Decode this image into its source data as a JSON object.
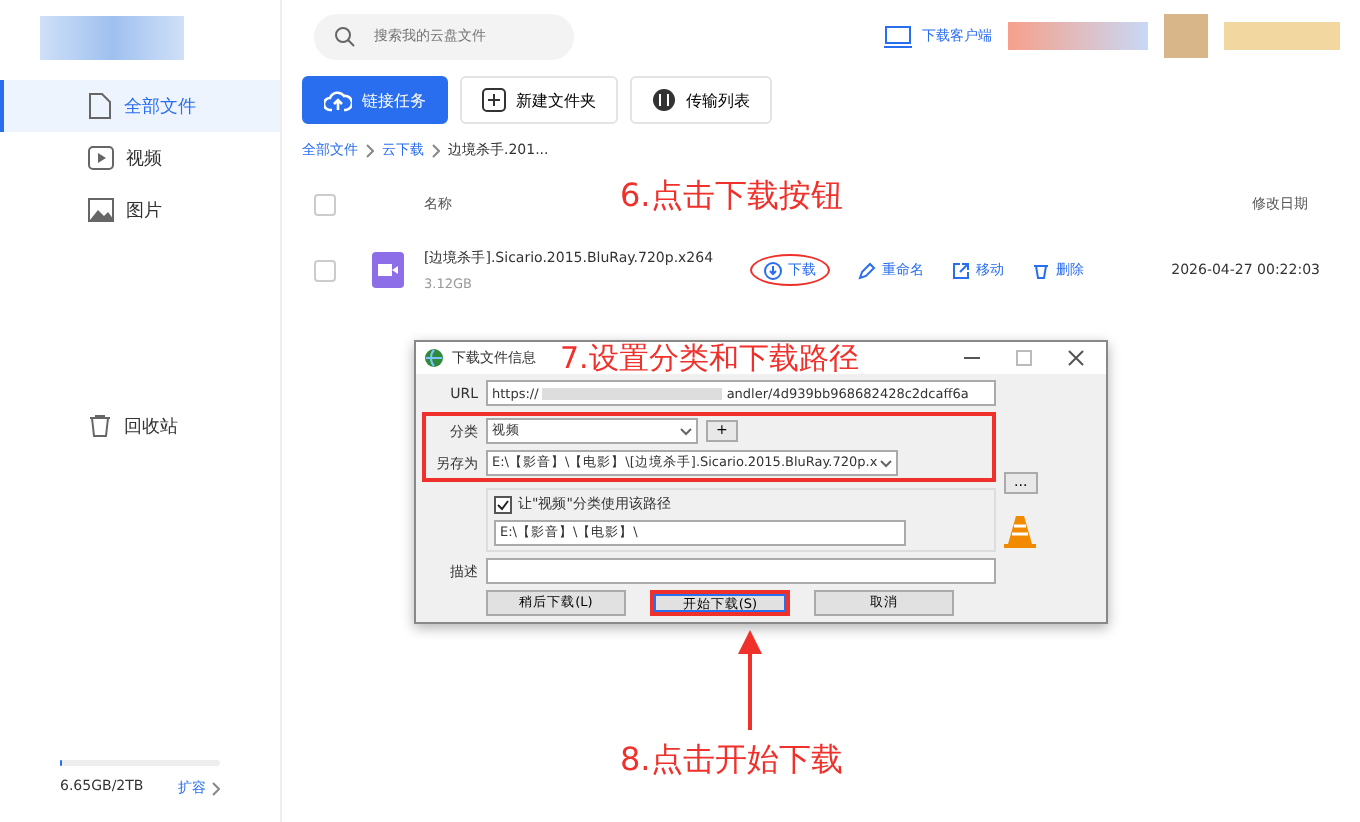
{
  "header": {
    "search": {
      "placeholder": "搜索我的云盘文件"
    },
    "client_link": "下载客户端"
  },
  "sidebar": {
    "items": [
      {
        "label": "全部文件",
        "selected": true
      },
      {
        "label": "视频",
        "selected": false
      },
      {
        "label": "图片",
        "selected": false
      }
    ],
    "trash": "回收站",
    "storage": {
      "level": 0.01,
      "used": "6.65GB/2TB",
      "expand": "扩容"
    }
  },
  "toolbar": [
    "链接任务",
    "新建文件夹",
    "传输列表"
  ],
  "breadcrumb": [
    "全部文件",
    "云下载",
    "边境杀手.201..."
  ],
  "table": {
    "all_checked": false,
    "columns": [
      "名称",
      "修改日期"
    ],
    "rows": [
      {
        "name": "[边境杀手].Sicario.2015.BluRay.720p.x264",
        "size": "3.12GB",
        "actions": [
          "下载",
          "重命名",
          "移动",
          "删除"
        ],
        "date": "2026-04-27 00:22:03",
        "selected": false,
        "checked": false
      }
    ]
  },
  "dialog": {
    "title": "下载文件信息",
    "url_label": "URL",
    "url_start": "https://",
    "url_end": "andler/4d939bb968682428c2dcaff6a",
    "category_label": "分类",
    "category": "视频",
    "add": "+",
    "saveas_label": "另存为",
    "saveas": "E:\\【影音】\\【电影】\\[边境杀手].Sicario.2015.BluRay.720p.x",
    "browse": "...",
    "remember": {
      "label": "让\"视频\"分类使用该路径",
      "checked": true
    },
    "path": "E:\\【影音】\\【电影】\\",
    "desc_label": "描述",
    "buttons": [
      {
        "label": "稍后下载(L)",
        "primary": false
      },
      {
        "label": "开始下载(S)",
        "primary": true
      },
      {
        "label": "取消",
        "primary": false
      }
    ]
  },
  "annotations": [
    "6.点击下载按钮",
    "7.设置分类和下载路径",
    "8.点击开始下载"
  ]
}
